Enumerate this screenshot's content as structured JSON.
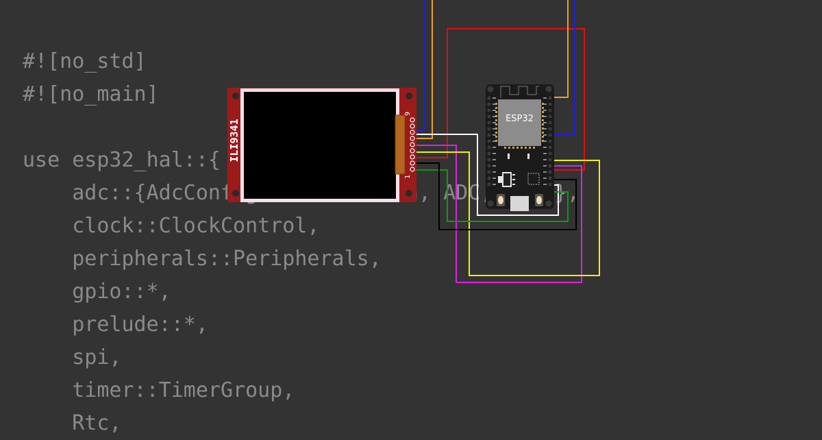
{
  "code_lines": [
    "#![no_std]",
    "#![no_main]",
    "",
    "use esp32_hal::{",
    "    adc::{AdcConfig, Attenuation, ADC, ADC2},",
    "    clock::ClockControl,",
    "    peripherals::Peripherals,",
    "    gpio::*,",
    "    prelude::*,",
    "    spi,",
    "    timer::TimerGroup,",
    "    Rtc,"
  ],
  "display": {
    "label": "ILI9341",
    "pin_first": "1",
    "pin_last": "9"
  },
  "board": {
    "label": "ESP32"
  },
  "colors": {
    "background": "#333333",
    "code_text": "#8a8a8a",
    "display_pcb": "#9b1b1b",
    "board_pcb": "#1b1b1b",
    "wire_blue": "#1f1fd8",
    "wire_orange": "#f0a020",
    "wire_red": "#e01010",
    "wire_white": "#ffffff",
    "wire_magenta": "#e020e0",
    "wire_yellow": "#f0f010",
    "wire_green": "#119911",
    "wire_black": "#000000"
  }
}
